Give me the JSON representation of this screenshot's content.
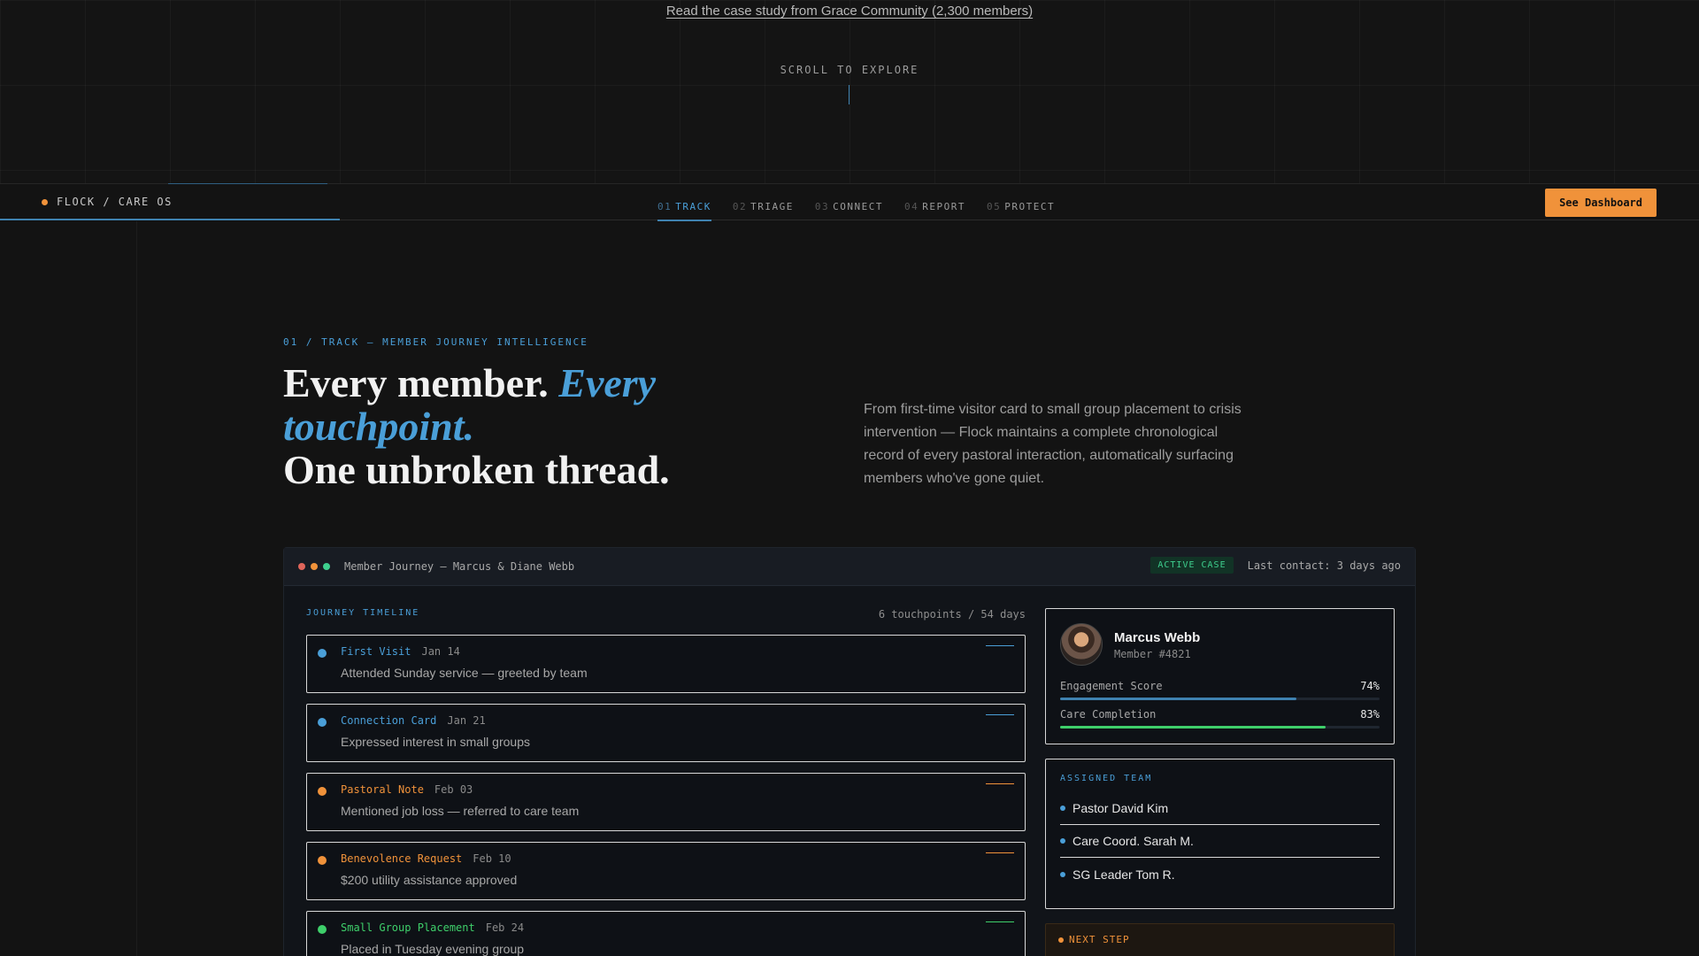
{
  "hero": {
    "case_study_link": "Read the case study from Grace Community (2,300 members)",
    "scroll_label": "SCROLL TO EXPLORE"
  },
  "nav": {
    "brand": "FLOCK / CARE OS",
    "tabs": [
      {
        "num": "01",
        "label": "TRACK",
        "active": true
      },
      {
        "num": "02",
        "label": "TRIAGE",
        "active": false
      },
      {
        "num": "03",
        "label": "CONNECT",
        "active": false
      },
      {
        "num": "04",
        "label": "REPORT",
        "active": false
      },
      {
        "num": "05",
        "label": "PROTECT",
        "active": false
      }
    ],
    "cta": "See Dashboard",
    "scroll_progress": 0.2
  },
  "section": {
    "eyebrow": "01 / TRACK — MEMBER JOURNEY INTELLIGENCE",
    "headline_a": "Every member. ",
    "headline_b": "Every touchpoint.",
    "headline_c": "One unbroken thread.",
    "lede": "From first-time visitor card to small group placement to crisis intervention — Flock maintains a complete chronological record of every pastoral interaction, automatically surfacing members who've gone quiet."
  },
  "panel": {
    "title": "Member Journey — Marcus & Diane Webb",
    "status_badge": "ACTIVE CASE",
    "last_contact": "Last contact: 3 days ago",
    "timeline_label": "JOURNEY TIMELINE",
    "timeline_count": "6 touchpoints / 54 days",
    "touchpoints": [
      {
        "title": "First Visit",
        "date": "Jan 14",
        "desc": "Attended Sunday service — greeted by team",
        "color": "#4a9fd8"
      },
      {
        "title": "Connection Card",
        "date": "Jan 21",
        "desc": "Expressed interest in small groups",
        "color": "#4a9fd8"
      },
      {
        "title": "Pastoral Note",
        "date": "Feb 03",
        "desc": "Mentioned job loss — referred to care team",
        "color": "#f0923a"
      },
      {
        "title": "Benevolence Request",
        "date": "Feb 10",
        "desc": "$200 utility assistance approved",
        "color": "#f0923a"
      },
      {
        "title": "Small Group Placement",
        "date": "Feb 24",
        "desc": "Placed in Tuesday evening group",
        "color": "#3ecf6a"
      }
    ],
    "profile": {
      "name": "Marcus Webb",
      "member_id": "Member #4821",
      "metrics": [
        {
          "label": "Engagement Score",
          "value_text": "74%",
          "value": 0.74,
          "color": "#3f82b0"
        },
        {
          "label": "Care Completion",
          "value_text": "83%",
          "value": 0.83,
          "color": "#3ecf6a"
        }
      ]
    },
    "team": {
      "label": "ASSIGNED TEAM",
      "members": [
        "Pastor David Kim",
        "Care Coord. Sarah M.",
        "SG Leader Tom R."
      ]
    },
    "next_step": {
      "label": "NEXT STEP"
    }
  },
  "colors": {
    "accent_blue": "#4a9fd8",
    "accent_orange": "#f0923a",
    "accent_green": "#3ecf6a",
    "traffic_red": "#e0655a",
    "traffic_yellow": "#f0923a",
    "traffic_green": "#3ecf8e"
  }
}
